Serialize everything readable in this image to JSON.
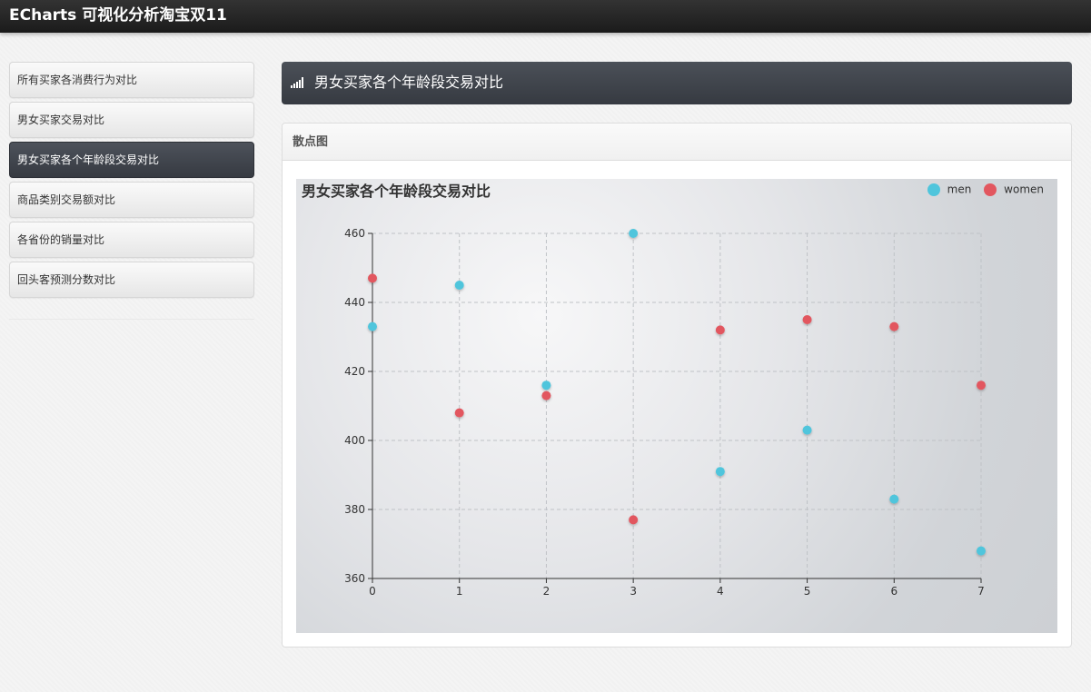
{
  "app": {
    "title": "ECharts 可视化分析淘宝双11"
  },
  "sidebar": {
    "items": [
      {
        "label": "所有买家各消费行为对比",
        "active": false
      },
      {
        "label": "男女买家交易对比",
        "active": false
      },
      {
        "label": "男女买家各个年龄段交易对比",
        "active": true
      },
      {
        "label": "商品类别交易额对比",
        "active": false
      },
      {
        "label": "各省份的销量对比",
        "active": false
      },
      {
        "label": "回头客预测分数对比",
        "active": false
      }
    ]
  },
  "header": {
    "title": "男女买家各个年龄段交易对比",
    "icon": "signal-icon"
  },
  "panel": {
    "title": "散点图"
  },
  "colors": {
    "men": "#4fc5dc",
    "women": "#e2575f",
    "active_nav": "#3b3f46"
  },
  "chart_data": {
    "type": "scatter",
    "title": "男女买家各个年龄段交易对比",
    "legend_position": "top-right",
    "grid": true,
    "x_ticks": [
      "0",
      "1",
      "2",
      "3",
      "4",
      "5",
      "6",
      "7"
    ],
    "y_ticks": [
      "360",
      "380",
      "400",
      "420",
      "440",
      "460"
    ],
    "xlim": [
      0,
      7
    ],
    "ylim": [
      360,
      460
    ],
    "series": [
      {
        "name": "men",
        "color": "#4fc5dc",
        "points": [
          [
            0,
            433
          ],
          [
            1,
            445
          ],
          [
            2,
            416
          ],
          [
            3,
            460
          ],
          [
            4,
            391
          ],
          [
            5,
            403
          ],
          [
            6,
            383
          ],
          [
            7,
            368
          ]
        ]
      },
      {
        "name": "women",
        "color": "#e2575f",
        "points": [
          [
            0,
            447
          ],
          [
            1,
            408
          ],
          [
            2,
            413
          ],
          [
            3,
            377
          ],
          [
            4,
            432
          ],
          [
            5,
            435
          ],
          [
            6,
            433
          ],
          [
            7,
            416
          ]
        ]
      }
    ]
  }
}
